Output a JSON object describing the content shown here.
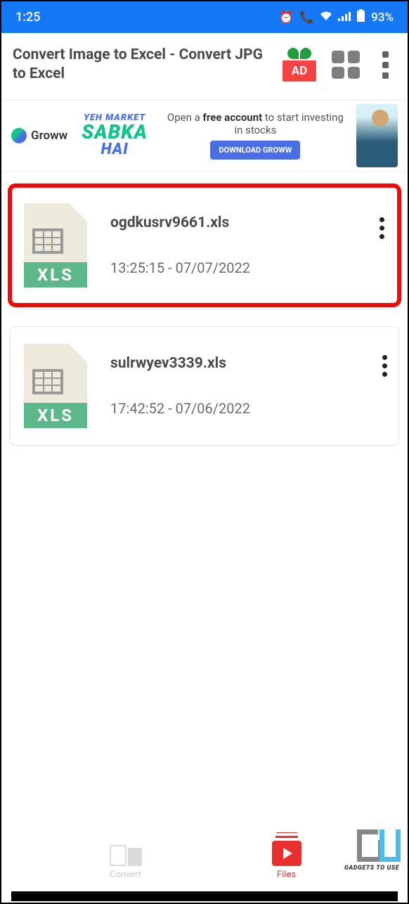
{
  "status": {
    "time": "1:25",
    "battery": "93%"
  },
  "header": {
    "title": "Convert Image to Excel - Convert JPG to Excel",
    "ad_label": "AD"
  },
  "banner": {
    "brand": "Groww",
    "tagline1": "YEH MARKET",
    "tagline2": "SABKA",
    "tagline3": "HAI",
    "cta_prefix": "Open a ",
    "cta_bold": "free account",
    "cta_suffix": " to start investing in stocks",
    "button": "DOWNLOAD GROWW"
  },
  "files": [
    {
      "name": "ogdkusrv9661.xls",
      "meta": "13:25:15 - 07/07/2022",
      "highlighted": true
    },
    {
      "name": "sulrwyev3339.xls",
      "meta": "17:42:52 - 07/06/2022",
      "highlighted": false
    }
  ],
  "xls_badge": "XLS",
  "nav": {
    "convert": "Convert",
    "files": "Files"
  },
  "watermark": "GADGETS TO USE"
}
